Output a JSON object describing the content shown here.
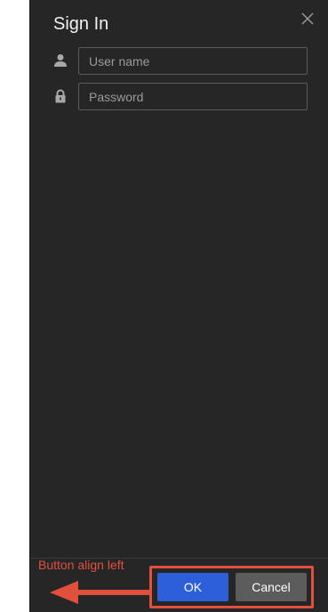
{
  "dialog": {
    "title": "Sign In",
    "close_icon": "close-icon"
  },
  "fields": {
    "username": {
      "placeholder": "User name",
      "value": "",
      "icon": "user-icon"
    },
    "password": {
      "placeholder": "Password",
      "value": "",
      "icon": "lock-icon"
    }
  },
  "footer": {
    "ok_label": "OK",
    "cancel_label": "Cancel"
  },
  "annotation": {
    "text": "Button align left",
    "color": "#e0503d"
  },
  "colors": {
    "dialog_bg": "#262626",
    "primary": "#2c5fd9",
    "secondary": "#5c5c5c"
  }
}
